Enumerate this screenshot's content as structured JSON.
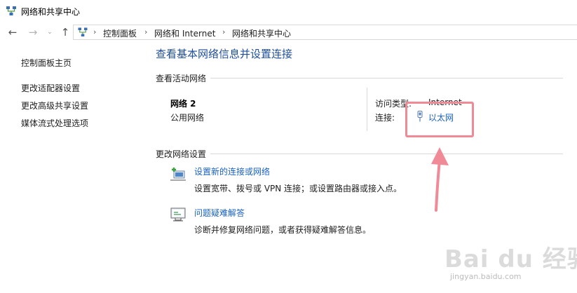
{
  "window": {
    "title": "网络和共享中心"
  },
  "nav": {
    "back": "←",
    "forward": "→",
    "dropdown": "⌄",
    "up": "↑"
  },
  "breadcrumb": {
    "items": [
      "控制面板",
      "网络和 Internet",
      "网络和共享中心"
    ],
    "separator": "›"
  },
  "sidebar": {
    "items": [
      {
        "label": "控制面板主页"
      },
      {
        "label": "更改适配器设置"
      },
      {
        "label": "更改高级共享设置"
      },
      {
        "label": "媒体流式处理选项"
      }
    ]
  },
  "main": {
    "title": "查看基本网络信息并设置连接",
    "active_networks": {
      "heading": "查看活动网络",
      "network_name": "网络 2",
      "network_type": "公用网络",
      "access_type_label": "访问类型:",
      "access_type_value": "Internet",
      "connections_label": "连接:",
      "connection_name": "以太网"
    },
    "change_settings": {
      "heading": "更改网络设置",
      "tasks": [
        {
          "title": "设置新的连接或网络",
          "desc": "设置宽带、拨号或 VPN 连接；或设置路由器或接入点。",
          "icon": "new-connection-icon"
        },
        {
          "title": "问题疑难解答",
          "desc": "诊断并修复网络问题，或者获得疑难解答信息。",
          "icon": "troubleshoot-icon"
        }
      ]
    }
  },
  "watermark": {
    "brand": "Bai du 经验",
    "url": "jingyan.baidu.com"
  },
  "colors": {
    "link": "#1a62c3",
    "title": "#1f4e9c",
    "highlight": "#f08a97"
  }
}
